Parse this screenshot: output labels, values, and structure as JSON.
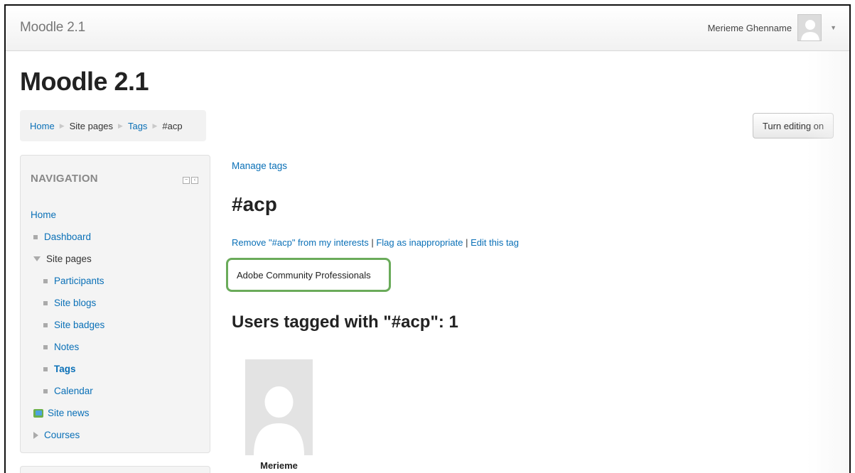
{
  "navbar": {
    "brand": "Moodle 2.1",
    "user_name": "Merieme Ghenname"
  },
  "page": {
    "heading": "Moodle 2.1",
    "edit_button": "Turn editing on"
  },
  "breadcrumb": {
    "items": [
      "Home",
      "Site pages",
      "Tags",
      "#acp"
    ]
  },
  "navigation": {
    "title": "NAVIGATION",
    "home": "Home",
    "dashboard": "Dashboard",
    "site_pages": "Site pages",
    "participants": "Participants",
    "site_blogs": "Site blogs",
    "site_badges": "Site badges",
    "notes": "Notes",
    "tags": "Tags",
    "calendar": "Calendar",
    "site_news": "Site news",
    "courses": "Courses"
  },
  "main": {
    "manage_tags": "Manage tags",
    "tag_name": "#acp",
    "remove_interest": "Remove \"#acp\" from my interests",
    "flag_inappropriate": "Flag as inappropriate",
    "edit_tag": "Edit this tag",
    "separator": " | ",
    "tag_description": "Adobe Community Professionals",
    "users_heading": "Users tagged with \"#acp\": 1",
    "user_name": "Merieme"
  },
  "colors": {
    "link": "#0a70b7",
    "highlight_border": "#6aab5a"
  }
}
